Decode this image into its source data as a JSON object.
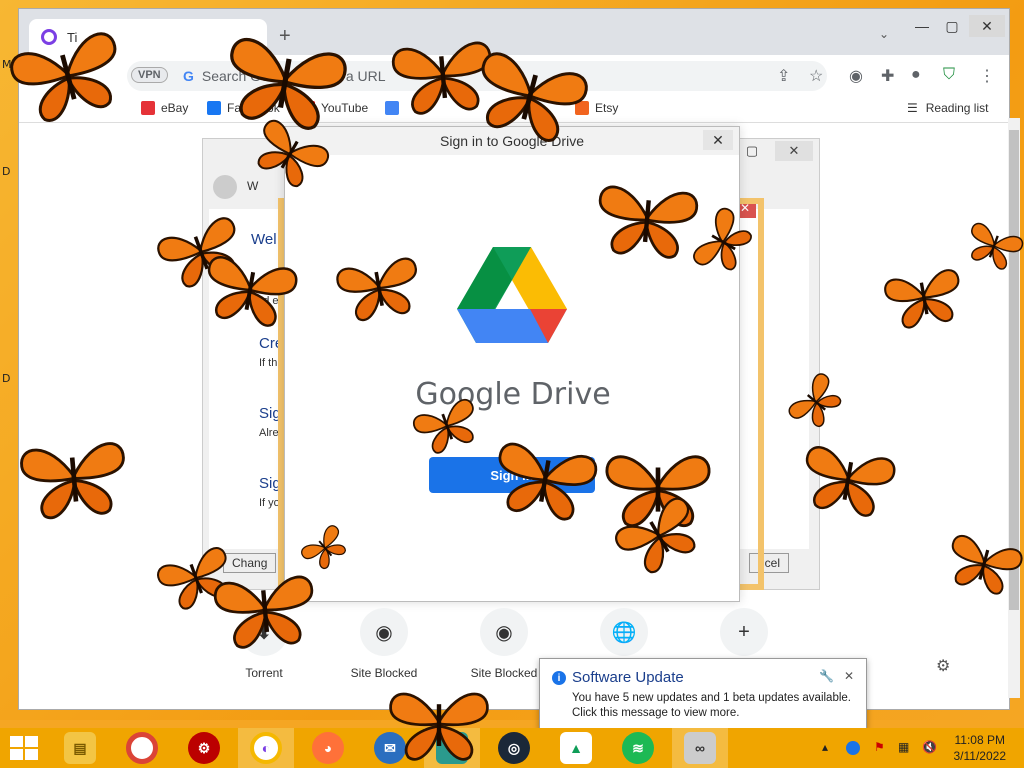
{
  "browser": {
    "tab_title": "Ti",
    "omnibox_placeholder": "Search Google or type a URL",
    "vpn_label": "VPN",
    "bookmarks": [
      {
        "label": "eBay",
        "color": "#e53238"
      },
      {
        "label": "Facebook",
        "color": "#1877f2"
      },
      {
        "label": "YouTube",
        "color": "#ff0000"
      },
      {
        "label": "",
        "color": "#4285f4"
      },
      {
        "label": "Etsy",
        "color": "#f1641e"
      }
    ],
    "reading_list": "Reading list",
    "shortcuts": [
      {
        "label": "Torrent",
        "icon": "torrent-icon"
      },
      {
        "label": "Site Blocked",
        "icon": "github-icon"
      },
      {
        "label": "Site Blocked",
        "icon": "github-icon"
      },
      {
        "label": "",
        "icon": "globe-icon"
      },
      {
        "label": "",
        "icon": "plus-icon"
      }
    ]
  },
  "back_dialog": {
    "items": [
      "Wel",
      "Cre",
      "Sig",
      "Sig"
    ],
    "subs": [
      "and e",
      "If th",
      "Alre",
      "If yo"
    ],
    "change_label": "Chang",
    "cancel_label": "ncel",
    "address_text": "W"
  },
  "front_dialog": {
    "title": "Sign in to Google Drive",
    "product_name": "Google Drive",
    "signin_button": "Sign in"
  },
  "notification": {
    "title": "Software Update",
    "line1": "You have 5 new updates and 1 beta updates available.",
    "line2": "Click this message to view more."
  },
  "taskbar": {
    "time": "11:08 PM",
    "date": "3/11/2022"
  },
  "desktop_letters": [
    "M",
    "D",
    "D"
  ]
}
